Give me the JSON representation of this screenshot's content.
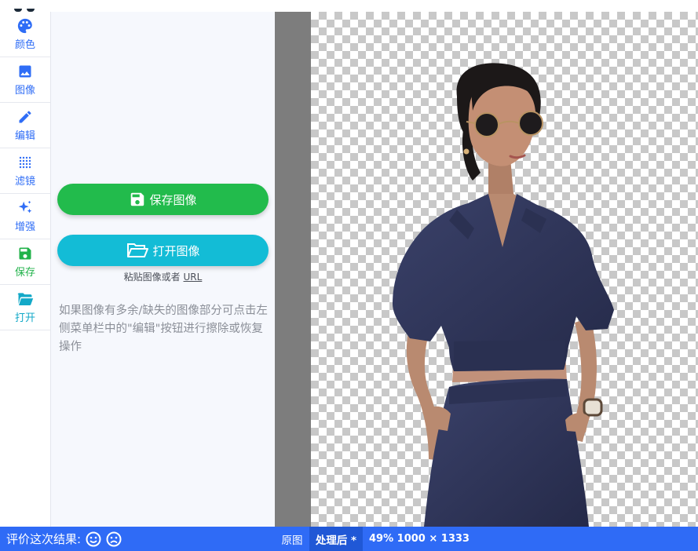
{
  "sidebar": {
    "items": [
      {
        "label": "颜色",
        "icon": "palette-icon"
      },
      {
        "label": "图像",
        "icon": "image-icon"
      },
      {
        "label": "编辑",
        "icon": "pencil-icon"
      },
      {
        "label": "滤镜",
        "icon": "dots-grid-icon"
      },
      {
        "label": "增强",
        "icon": "sparkle-icon"
      },
      {
        "label": "保存",
        "icon": "save-icon"
      },
      {
        "label": "打开",
        "icon": "folder-open-icon"
      }
    ]
  },
  "panel": {
    "save_button": "保存图像",
    "open_button": "打开图像",
    "paste_hint": "粘贴图像或者",
    "paste_url": "URL",
    "info_text": "如果图像有多余/缺失的图像部分可点击左侧菜单栏中的\"编辑\"按钮进行擦除或恢复操作"
  },
  "statusbar": {
    "rate_label": "评价这次结果:",
    "tab_original": "原图",
    "tab_processed": "处理后 *",
    "zoom_info": "49% 1000 × 1333"
  },
  "colors": {
    "accent_blue": "#2f6bf6",
    "save_green": "#22bb4c",
    "open_teal": "#13bcd6",
    "panel_bg": "#f6f8fd",
    "outfit_navy": "#2d3356"
  }
}
